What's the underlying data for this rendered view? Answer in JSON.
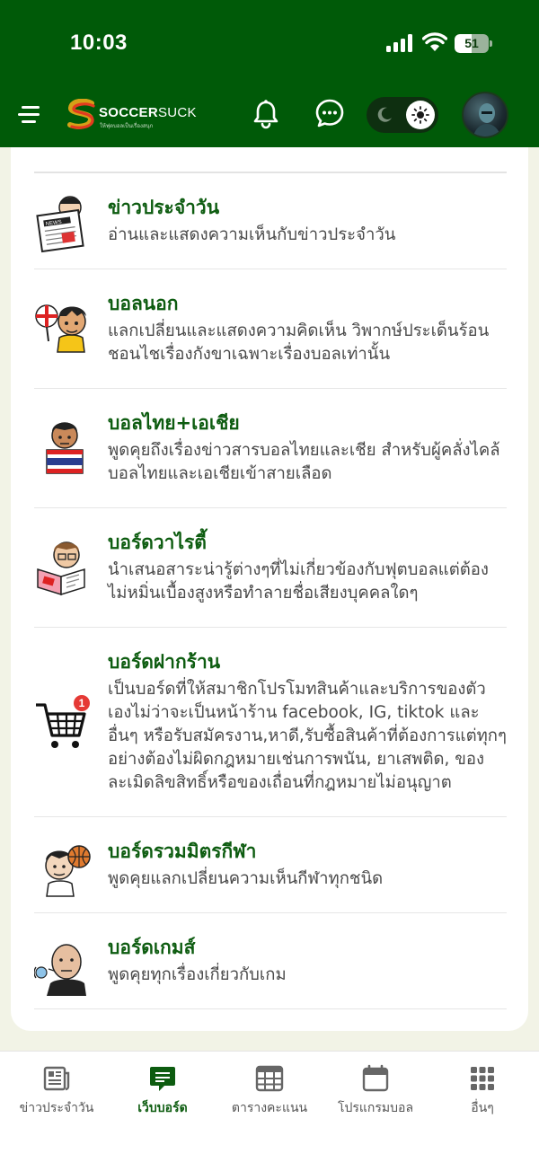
{
  "status_bar": {
    "time": "10:03",
    "battery": "51",
    "battery_level": 0.51
  },
  "header": {
    "logo_text_bold": "SOCCER",
    "logo_text_light": "SUCK",
    "logo_tagline": "ให้ฟุตบอลเป็นเรื่องสนุก",
    "theme": "light",
    "colors": {
      "header_bg": "#005a08",
      "accent": "#0d5c10"
    }
  },
  "boards": [
    {
      "title": "ข่าวประจำวัน",
      "desc": "อ่านและแสดงความเห็นกับข่าวประจำวัน",
      "icon": "news-reader-icon"
    },
    {
      "title": "บอลนอก",
      "desc": "แลกเปลี่ยนและแสดงความคิดเห็น วิพากษ์ประเด็นร้อน ชอนไชเรื่องกังขาเฉพาะเรื่องบอลเท่านั้น",
      "icon": "england-fan-icon"
    },
    {
      "title": "บอลไทย+เอเชีย",
      "desc": "พูดคุยถึงเรื่องข่าวสารบอลไทยและเชีย สำหรับผู้คลั่งไคล้บอลไทยและเอเชียเข้าสายเลือด",
      "icon": "thai-fan-icon"
    },
    {
      "title": "บอร์ดวาไรตี้",
      "desc": "นำเสนอสาระน่ารู้ต่างๆที่ไม่เกี่ยวข้องกับฟุตบอลแต่ต้องไม่หมิ่นเบื้องสูงหรือทำลายชื่อเสียงบุคคลใดๆ",
      "icon": "magazine-reader-icon"
    },
    {
      "title": "บอร์ดฝากร้าน",
      "desc": "เป็นบอร์ดที่ให้สมาชิกโปรโมทสินค้าและบริการของตัวเองไม่ว่าจะเป็นหน้าร้าน facebook, IG, tiktok และอื่นๆ หรือรับสมัครงาน,หาดี,รับซื้อสินค้าที่ต้องการแต่ทุกๆอย่างต้องไม่ผิดกฎหมายเช่นการพนัน, ยาเสพติด, ของละเมิดลิขสิทธิ์หรือของเถื่อนที่กฎหมายไม่อนุญาต",
      "icon": "shopping-cart-icon",
      "badge": "1"
    },
    {
      "title": "บอร์ดรวมมิตรกีฬา",
      "desc": "พูดคุยแลกเปลี่ยนความเห็นกีฬาทุกชนิด",
      "icon": "basketball-fan-icon"
    },
    {
      "title": "บอร์ดเกมส์",
      "desc": "พูดคุยทุกเรื่องเกี่ยวกับเกม",
      "icon": "gamer-icon"
    }
  ],
  "bottom_nav": [
    {
      "label": "ข่าวประจำวัน",
      "icon": "newspaper-icon",
      "active": false
    },
    {
      "label": "เว็บบอร์ด",
      "icon": "webboard-chat-icon",
      "active": true
    },
    {
      "label": "ตารางคะแนน",
      "icon": "table-grid-icon",
      "active": false
    },
    {
      "label": "โปรแกรมบอล",
      "icon": "calendar-icon",
      "active": false
    },
    {
      "label": "อื่นๆ",
      "icon": "apps-grid-icon",
      "active": false
    }
  ]
}
